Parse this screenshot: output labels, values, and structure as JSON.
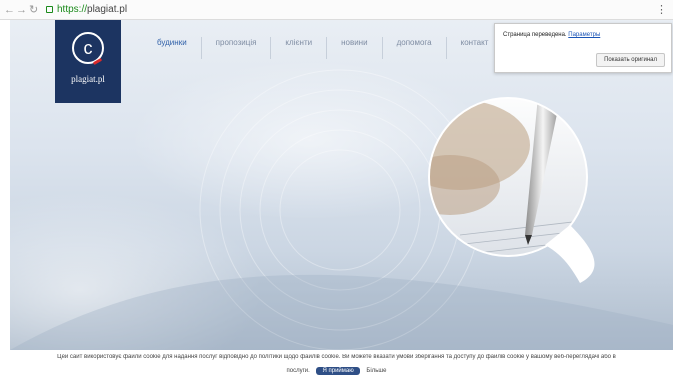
{
  "browser": {
    "back_glyph": "←",
    "forward_glyph": "→",
    "reload_glyph": "↻",
    "url_proto": "https://",
    "url_host": "plagiat.pl",
    "menu_glyph": "⋮"
  },
  "logo": {
    "mark": "c",
    "brand": "plagiat.pl",
    "bg_color": "#1c3461",
    "accent_color": "#d92a2a"
  },
  "nav": {
    "items": [
      {
        "label": "будинки"
      },
      {
        "label": "пропозиція"
      },
      {
        "label": "клієнти"
      },
      {
        "label": "новини"
      },
      {
        "label": "допомога"
      },
      {
        "label": "контакт"
      }
    ]
  },
  "translate_popup": {
    "text": "Страница переведена.",
    "settings_link": "Параметры",
    "show_original": "Показать оригинал"
  },
  "slider": {
    "prev_glyph": "‹",
    "next_glyph": "›"
  },
  "cookie": {
    "message": "Цей сайт використовує файли cookie для надання послуг відповідно до політики щодо файлів cookie. Ви можете вказати умови зберігання та доступу до файлів cookie у вашому веб-переглядачі або в",
    "message_tail": "послуги.",
    "accept_label": "Я приймаю",
    "more_label": "Більше"
  }
}
